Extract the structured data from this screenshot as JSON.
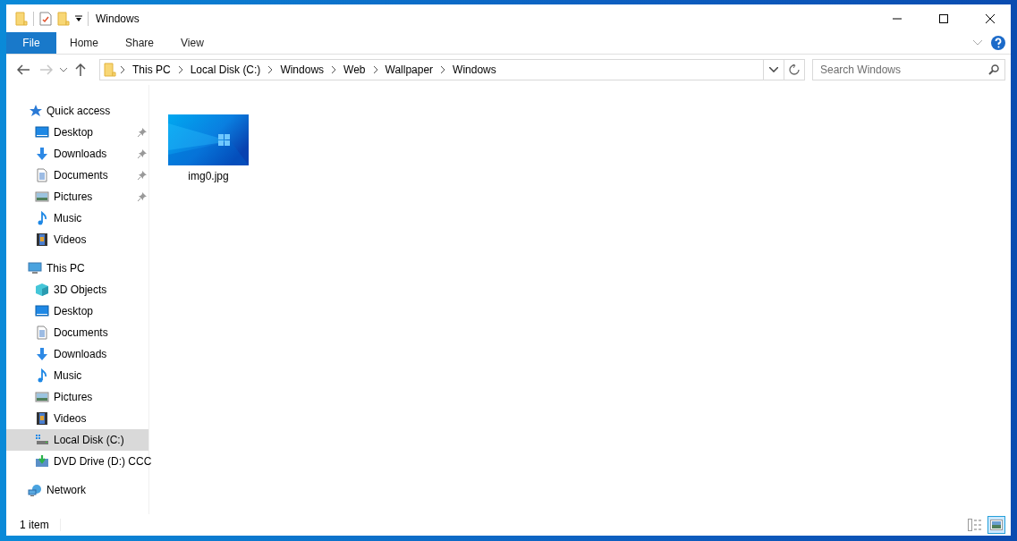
{
  "window": {
    "title": "Windows"
  },
  "ribbon": {
    "tabs": [
      {
        "label": "File",
        "selected": true
      },
      {
        "label": "Home",
        "selected": false
      },
      {
        "label": "Share",
        "selected": false
      },
      {
        "label": "View",
        "selected": false
      }
    ]
  },
  "address_bar": {
    "path": [
      "This PC",
      "Local Disk (C:)",
      "Windows",
      "Web",
      "Wallpaper",
      "Windows"
    ]
  },
  "search": {
    "placeholder": "Search Windows"
  },
  "navigation_pane": {
    "items": [
      {
        "label": "Quick access",
        "selected": false,
        "children": [
          {
            "label": "Desktop",
            "pinned": true,
            "selected": false
          },
          {
            "label": "Downloads",
            "pinned": true,
            "selected": false
          },
          {
            "label": "Documents",
            "pinned": true,
            "selected": false
          },
          {
            "label": "Pictures",
            "pinned": true,
            "selected": false
          },
          {
            "label": "Music",
            "pinned": false,
            "selected": false
          },
          {
            "label": "Videos",
            "pinned": false,
            "selected": false
          }
        ]
      },
      {
        "label": "This PC",
        "selected": false,
        "children": [
          {
            "label": "3D Objects",
            "selected": false
          },
          {
            "label": "Desktop",
            "selected": false
          },
          {
            "label": "Documents",
            "selected": false
          },
          {
            "label": "Downloads",
            "selected": false
          },
          {
            "label": "Music",
            "selected": false
          },
          {
            "label": "Pictures",
            "selected": false
          },
          {
            "label": "Videos",
            "selected": false
          },
          {
            "label": "Local Disk (C:)",
            "selected": true
          },
          {
            "label": "DVD Drive (D:) CCC",
            "selected": false
          }
        ]
      },
      {
        "label": "Network",
        "selected": false
      }
    ]
  },
  "files": [
    {
      "name": "img0.jpg",
      "kind": "picture"
    }
  ],
  "status_bar": {
    "text": "1 item",
    "views": [
      {
        "kind": "details",
        "selected": false
      },
      {
        "kind": "large_icons",
        "selected": true
      }
    ]
  }
}
